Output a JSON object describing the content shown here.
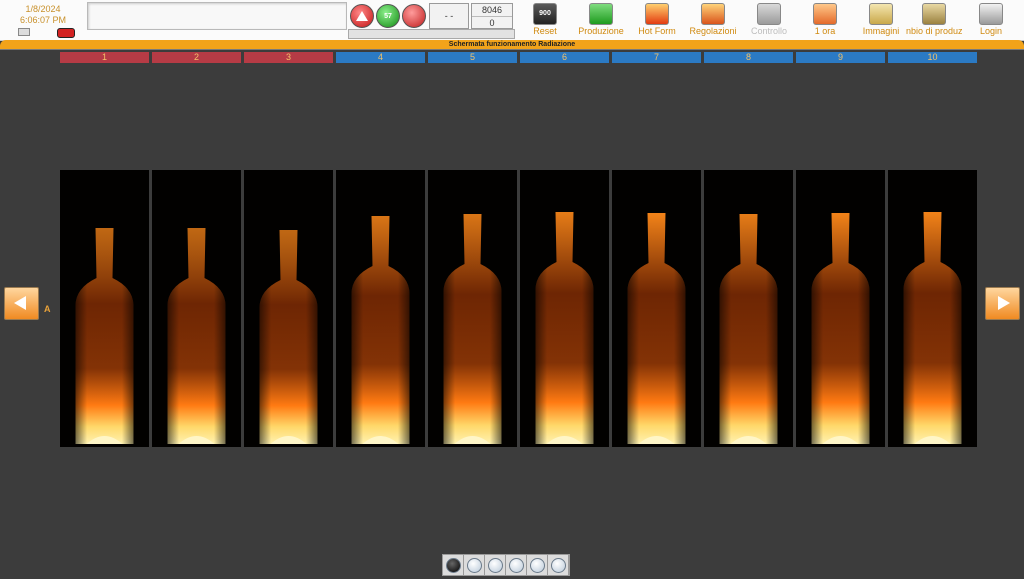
{
  "header": {
    "date": "1/8/2024",
    "time": "6:06:07 PM",
    "status_count": "57",
    "counter_dash": "- -",
    "counter_top": "8046",
    "counter_bottom": "0",
    "reset_value": "900"
  },
  "toolbar": [
    {
      "label": "Reset",
      "icon": "reset-icon",
      "enabled": true
    },
    {
      "label": "Produzione",
      "icon": "production-icon",
      "enabled": true
    },
    {
      "label": "Hot Form",
      "icon": "hot-form-icon",
      "enabled": true
    },
    {
      "label": "Regolazioni",
      "icon": "adjustments-icon",
      "enabled": true
    },
    {
      "label": "Controllo",
      "icon": "play-icon",
      "enabled": false
    },
    {
      "label": "1 ora",
      "icon": "clock-icon",
      "enabled": true
    },
    {
      "label": "Immagini",
      "icon": "images-icon",
      "enabled": true
    },
    {
      "label": "nbio di produzi",
      "icon": "production-change-icon",
      "enabled": true
    },
    {
      "label": "Login",
      "icon": "lock-icon",
      "enabled": true
    }
  ],
  "screen_title": "Schermata funzionamento Radiazione",
  "row_label": "A",
  "cavities": [
    {
      "label": "1",
      "group": "red"
    },
    {
      "label": "2",
      "group": "red"
    },
    {
      "label": "3",
      "group": "red"
    },
    {
      "label": "4",
      "group": "blue"
    },
    {
      "label": "5",
      "group": "blue"
    },
    {
      "label": "6",
      "group": "blue"
    },
    {
      "label": "7",
      "group": "blue"
    },
    {
      "label": "8",
      "group": "blue"
    },
    {
      "label": "9",
      "group": "blue"
    },
    {
      "label": "10",
      "group": "blue"
    }
  ],
  "pager": {
    "pages": 6,
    "active": 1
  },
  "colors": {
    "accent": "#f2a31a",
    "header_red": "#b63b45",
    "header_blue": "#2b7ac4",
    "label_orange": "#d08a10"
  }
}
